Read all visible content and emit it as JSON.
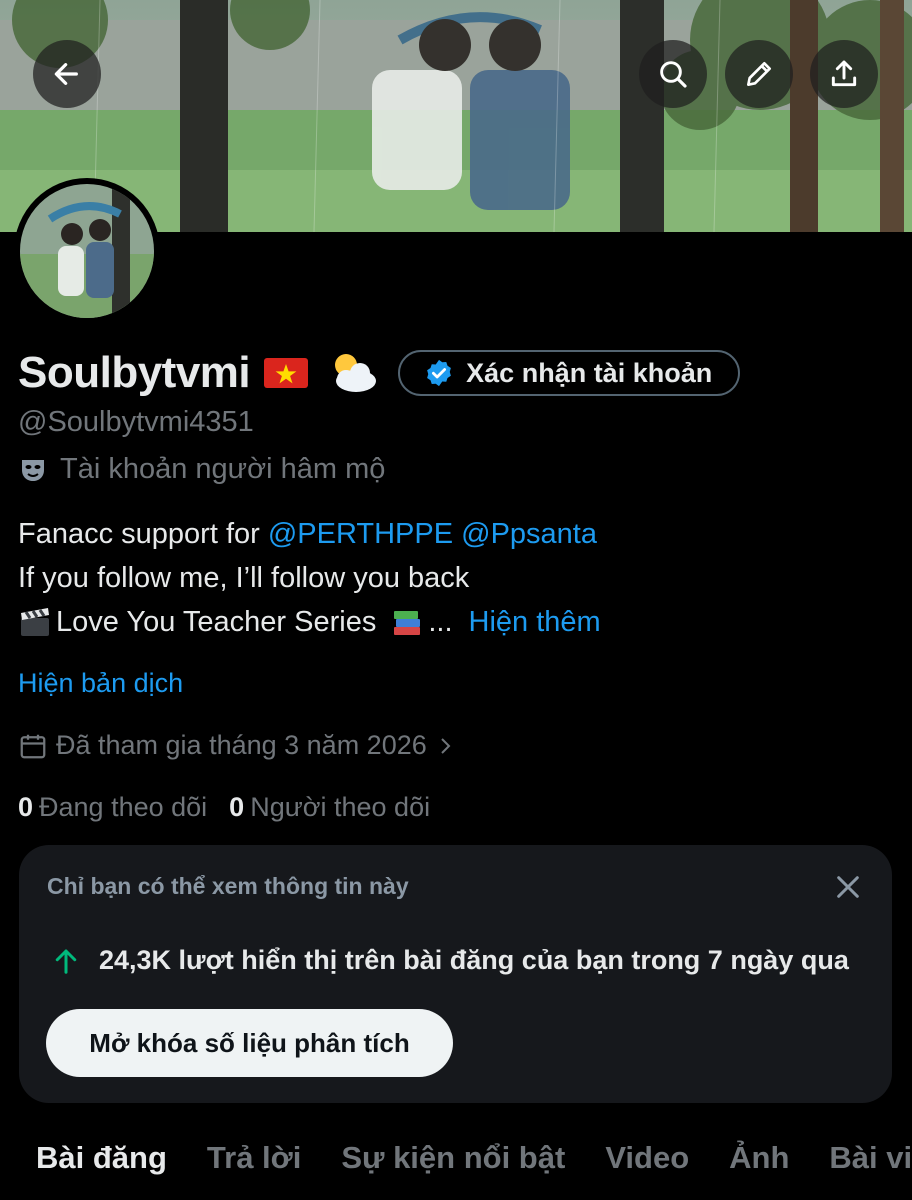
{
  "header": {
    "back_icon": "arrow-left-icon",
    "search_icon": "search-icon",
    "edit_icon": "pencil-icon",
    "share_icon": "share-icon"
  },
  "profile": {
    "display_name": "Soulbytvmi",
    "emojis": [
      "vietnam-flag",
      "sun-behind-cloud"
    ],
    "verify_label": "Xác nhận tài khoản",
    "handle": "@Soulbytvmi4351",
    "account_type": "Tài khoản người hâm mộ",
    "bio": {
      "line1_prefix": "Fanacc support for ",
      "mention1": "@PERTHPPE",
      "mention2": "@Ppsanta",
      "line2": "If you follow me, I’ll follow you back",
      "line3_text": "Love You Teacher Series",
      "line3_ellipsis": "...",
      "show_more": "Hiện thêm"
    },
    "translate_label": "Hiện bản dịch",
    "joined": "Đã tham gia tháng 3 năm 2026",
    "following_count": "0",
    "following_label": "Đang theo dõi",
    "followers_count": "0",
    "followers_label": "Người theo dõi"
  },
  "analytics_card": {
    "note": "Chỉ bạn có thể xem thông tin này",
    "stat": "24,3K lượt hiển thị trên bài đăng của bạn trong 7 ngày qua",
    "button": "Mở khóa số liệu phân tích"
  },
  "tabs": [
    {
      "label": "Bài đăng",
      "active": true
    },
    {
      "label": "Trả lời"
    },
    {
      "label": "Sự kiện nổi bật"
    },
    {
      "label": "Video"
    },
    {
      "label": "Ảnh"
    },
    {
      "label": "Bài viết"
    }
  ],
  "colors": {
    "background": "#000000",
    "link": "#1d9bf0",
    "muted": "#71767b",
    "card": "#16181c",
    "up_arrow": "#00ba7c"
  }
}
